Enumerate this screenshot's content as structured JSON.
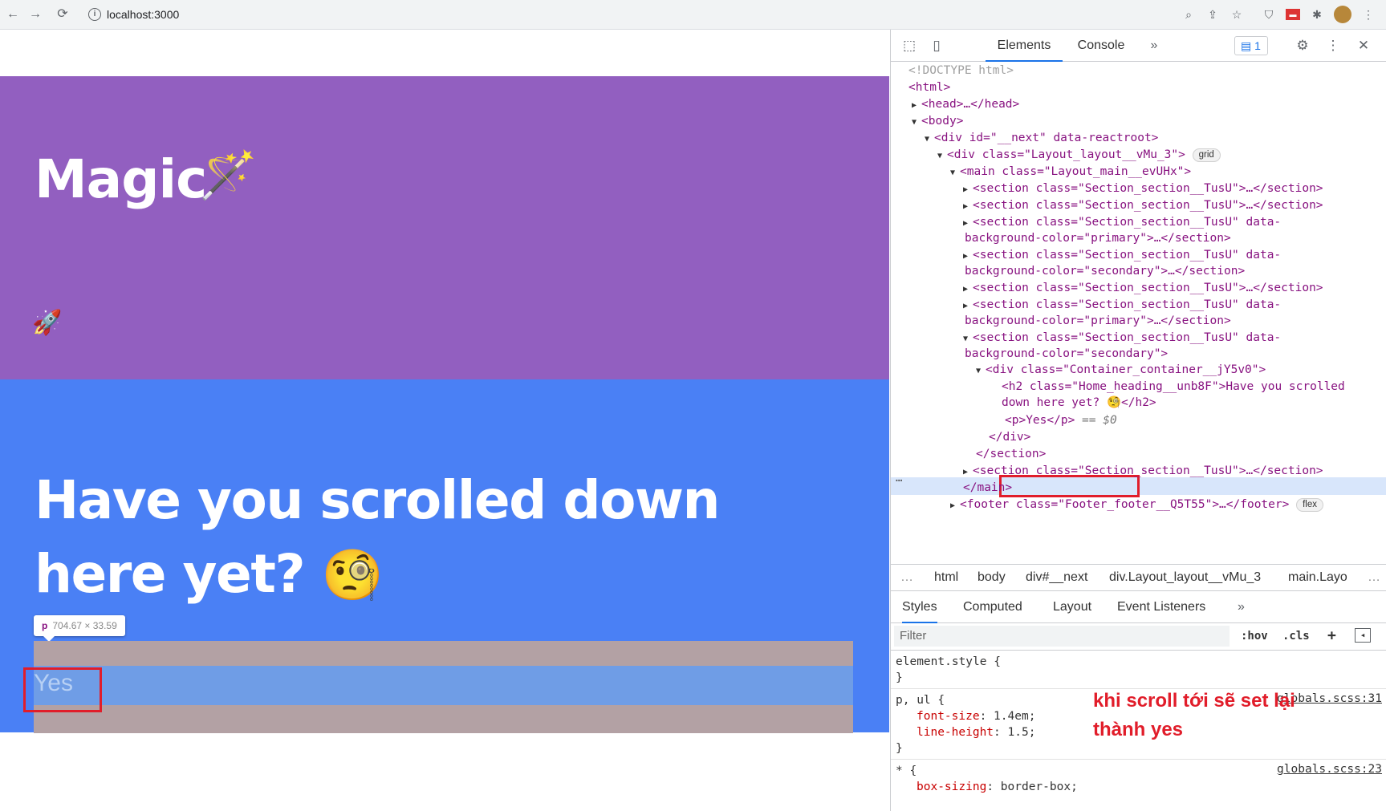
{
  "browser": {
    "url": "localhost:3000",
    "back_icon": "←",
    "forward_icon": "→",
    "reload_icon": "⟳",
    "info_icon": "i"
  },
  "page": {
    "magic_title": "Magic",
    "magic_emoji": "🪄",
    "rocket_emoji": "🚀",
    "heading": "Have you scrolled down here yet?",
    "heading_emoji": "🧐",
    "tooltip_tag": "p",
    "tooltip_dims": "704.67 × 33.59",
    "paragraph": "Yes",
    "colors": {
      "purple": "#925fc0",
      "blue": "#4a80f5",
      "highlight": "#e11d2a"
    }
  },
  "devtools": {
    "tabs": [
      "Elements",
      "Console"
    ],
    "more_tabs": "»",
    "issues_count": "1",
    "dom": {
      "doctype": "<!DOCTYPE html>",
      "html_open": "<html>",
      "head": "<head>…</head>",
      "body_open": "<body>",
      "div_next": "<div id=\"__next\" data-reactroot>",
      "div_layout": "<div class=\"Layout_layout__vMu_3\">",
      "grid_badge": "grid",
      "main_open": "<main class=\"Layout_main__evUHx\">",
      "section_collapsed": "<section class=\"Section_section__TusU\">…</section>",
      "section_primary_1": "<section class=\"Section_section__TusU\" data-",
      "section_primary_2": "background-color=\"primary\">…</section>",
      "section_secondary_1": "<section class=\"Section_section__TusU\" data-",
      "section_secondary_2": "background-color=\"secondary\">…</section>",
      "section_open_1": "<section class=\"Section_section__TusU\" data-",
      "section_open_2": "background-color=\"secondary\">",
      "div_container": "<div class=\"Container_container__jY5v0\">",
      "h2_1": "<h2 class=\"Home_heading__unb8F\">Have you scrolled",
      "h2_2": "down here yet? 🧐</h2>",
      "p_selected": "<p>Yes</p>",
      "p_dollar": "== $0",
      "div_close": "</div>",
      "section_close": "</section>",
      "main_close": "</main>",
      "footer": "<footer class=\"Footer_footer__Q5T55\">…</footer>",
      "flex_badge": "flex",
      "ellipsis": "…"
    },
    "breadcrumb": [
      "…",
      "html",
      "body",
      "div#__next",
      "div.Layout_layout__vMu_3",
      "main.Layo",
      "…"
    ],
    "styles_tabs": [
      "Styles",
      "Computed",
      "Layout",
      "Event Listeners",
      "»"
    ],
    "filter_placeholder": "Filter",
    "hov": ":hov",
    "cls": ".cls",
    "plus": "+",
    "rules": {
      "element_style": "element.style {",
      "close_brace": "}",
      "p_ul": "p, ul {",
      "p_ul_src": "globals.scss:31",
      "font_size_prop": "font-size",
      "font_size_val": "1.4em;",
      "line_height_prop": "line-height",
      "line_height_val": "1.5;",
      "star": "* {",
      "star_src": "globals.scss:23",
      "box_sizing_prop": "box-sizing",
      "box_sizing_val": "border-box;"
    },
    "annotation": "khi scroll tới sẽ set lại thành yes"
  }
}
